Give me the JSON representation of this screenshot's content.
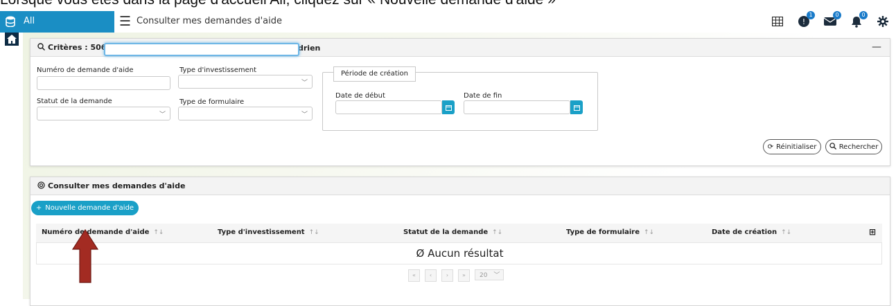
{
  "instruction": "Lorsque vous êtes dans la page d'accueil All, cliquez sur « Nouvelle demande d'aide »",
  "sidebar": {
    "label": "All"
  },
  "header": {
    "menu_title": "Consulter mes demandes d'aide",
    "badges": {
      "help": "1",
      "mail": "0",
      "bell": "0"
    }
  },
  "criteria": {
    "title_prefix": "Critères : 5068",
    "title_suffix": "drien",
    "collapse": "—",
    "fields": {
      "numero_label": "Numéro de demande d'aide",
      "type_invest_label": "Type d'investissement",
      "statut_label": "Statut de la demande",
      "type_form_label": "Type de formulaire"
    },
    "periode": {
      "legend": "Période de création",
      "start_label": "Date de début",
      "end_label": "Date de fin"
    },
    "reset_label": "Réinitialiser",
    "search_label": "Rechercher"
  },
  "list": {
    "title": "Consulter mes demandes d'aide",
    "new_button": "Nouvelle demande d'aide",
    "columns": [
      "Numéro de demande d'aide",
      "Type d'investissement",
      "Statut de la demande",
      "Type de formulaire",
      "Date de création"
    ],
    "empty": "Aucun résultat",
    "page_size": "20"
  },
  "colors": {
    "accent": "#1aa0c7",
    "sidebar": "#1a8ec4",
    "arrow": "#a32b22"
  }
}
